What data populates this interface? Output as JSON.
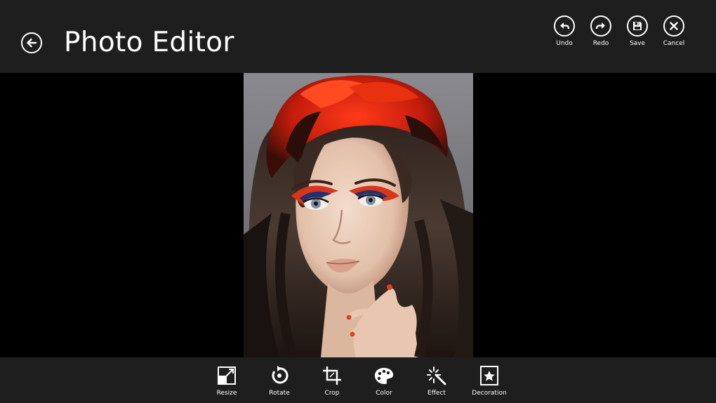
{
  "header": {
    "title": "Photo Editor",
    "back_icon": "back-arrow-icon"
  },
  "commands": [
    {
      "label": "Undo",
      "icon": "undo-icon"
    },
    {
      "label": "Redo",
      "icon": "redo-icon"
    },
    {
      "label": "Save",
      "icon": "save-icon"
    },
    {
      "label": "Cancel",
      "icon": "cancel-icon"
    }
  ],
  "tools": [
    {
      "label": "Resize",
      "icon": "resize-icon"
    },
    {
      "label": "Rotate",
      "icon": "rotate-icon"
    },
    {
      "label": "Crop",
      "icon": "crop-icon"
    },
    {
      "label": "Color",
      "icon": "palette-icon"
    },
    {
      "label": "Effect",
      "icon": "magic-wand-icon"
    },
    {
      "label": "Decoration",
      "icon": "star-frame-icon"
    }
  ],
  "colors": {
    "bar_background": "#1e1e1e",
    "canvas_background": "#000000",
    "foreground": "#ffffff"
  }
}
